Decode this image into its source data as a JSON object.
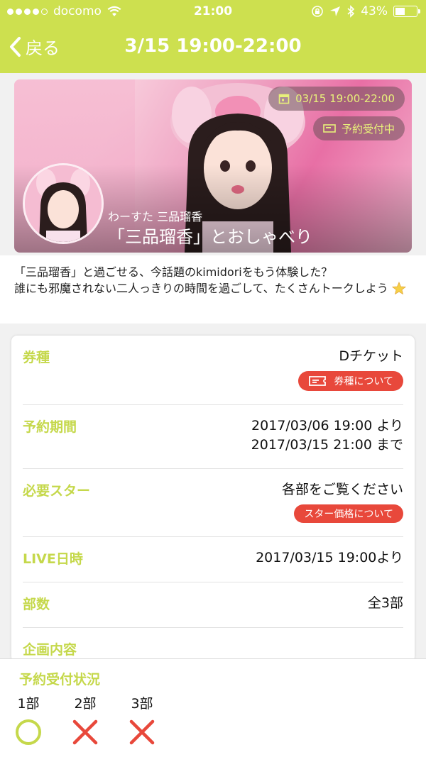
{
  "status_bar": {
    "carrier": "docomo",
    "time": "21:00",
    "battery": "43%",
    "battery_level": 0.43
  },
  "nav": {
    "back_label": "戻る",
    "title": "3/15 19:00-22:00"
  },
  "hero": {
    "date_pill": "03/15 19:00-22:00",
    "status_pill": "予約受付中",
    "subtitle": "わーすた 三品瑠香",
    "title": "「三品瑠香」とおしゃべり"
  },
  "description": {
    "line1": "「三品瑠香」と過ごせる、今話題のkimidoriをもう体験した？",
    "line2": "誰にも邪魔されない二人っきりの時間を過ごして、たくさんトークしよう"
  },
  "info": {
    "ticket_type": {
      "label": "券種",
      "value": "Dチケット",
      "button": "券種について"
    },
    "reservation_period": {
      "label": "予約期間",
      "value1": "2017/03/06 19:00 より",
      "value2": "2017/03/15 21:00 まで"
    },
    "required_stars": {
      "label": "必要スター",
      "value": "各部をご覧ください",
      "button": "スター価格について"
    },
    "live_datetime": {
      "label": "LIVE日時",
      "value": "2017/03/15 19:00より"
    },
    "parts": {
      "label": "部数",
      "value": "全3部"
    },
    "plan": {
      "label": "企画内容"
    }
  },
  "availability": {
    "title": "予約受付状況",
    "slots": [
      {
        "name": "1部",
        "status": "available"
      },
      {
        "name": "2部",
        "status": "unavailable"
      },
      {
        "name": "3部",
        "status": "unavailable"
      }
    ]
  },
  "colors": {
    "accent": "#cde04f",
    "label": "#c5d84b",
    "red": "#e8483b"
  }
}
